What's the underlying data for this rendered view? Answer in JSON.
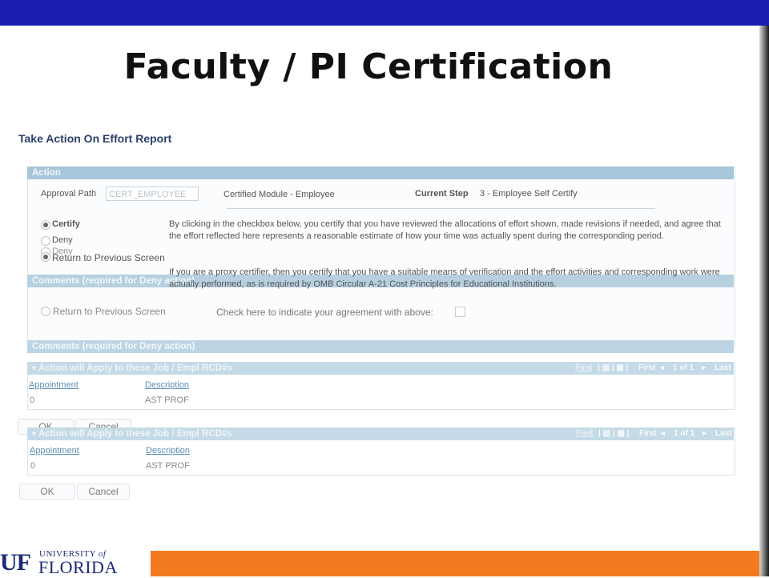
{
  "slide": {
    "title": "Faculty / PI Certification"
  },
  "page": {
    "header": "Take Action On Effort Report"
  },
  "action": {
    "section_title": "Action",
    "approval_path_label": "Approval Path",
    "approval_path_value": "CERT_EMPLOYEE",
    "module": "Certified Module - Employee",
    "current_step_label": "Current Step",
    "current_step_value": "3 - Employee Self Certify",
    "options": [
      "Certify",
      "Deny",
      "Deny",
      "Return to Previous Screen",
      "Return to Previous Screen"
    ],
    "selected": "Certify",
    "paragraph1": "By clicking in the checkbox below, you certify that you have reviewed the allocations of effort shown, made revisions if needed, and agree that the effort reflected here represents a reasonable estimate of how your time was actually spent during the corresponding period.",
    "paragraph2": "If you are a proxy certifier, then you certify that you have a suitable means of verification and the effort activities and corresponding work were actually performed, as is required by OMB Circular A-21 Cost Principles for Educational Institutions.",
    "agreement_label": "Check here to indicate your agreement with above:",
    "agreement_checked": false
  },
  "comments": {
    "section_title": "Comments (required for Deny action)"
  },
  "grid": {
    "title": "Action will Apply to these Job / Empl RCD#s",
    "find": "Find",
    "first": "First",
    "pager": "1 of 1",
    "last": "Last",
    "columns": [
      "Appointment",
      "Description"
    ],
    "rows": [
      {
        "appointment": "0",
        "description": "AST PROF"
      }
    ]
  },
  "buttons": {
    "ok": "OK",
    "cancel": "Cancel"
  },
  "logo": {
    "text": "UF UNIVERSITY of FLORIDA"
  },
  "colors": {
    "top_bar": "#1a1fb0",
    "footer_bar": "#f47a20",
    "section_bar": "#a8c6d9"
  }
}
